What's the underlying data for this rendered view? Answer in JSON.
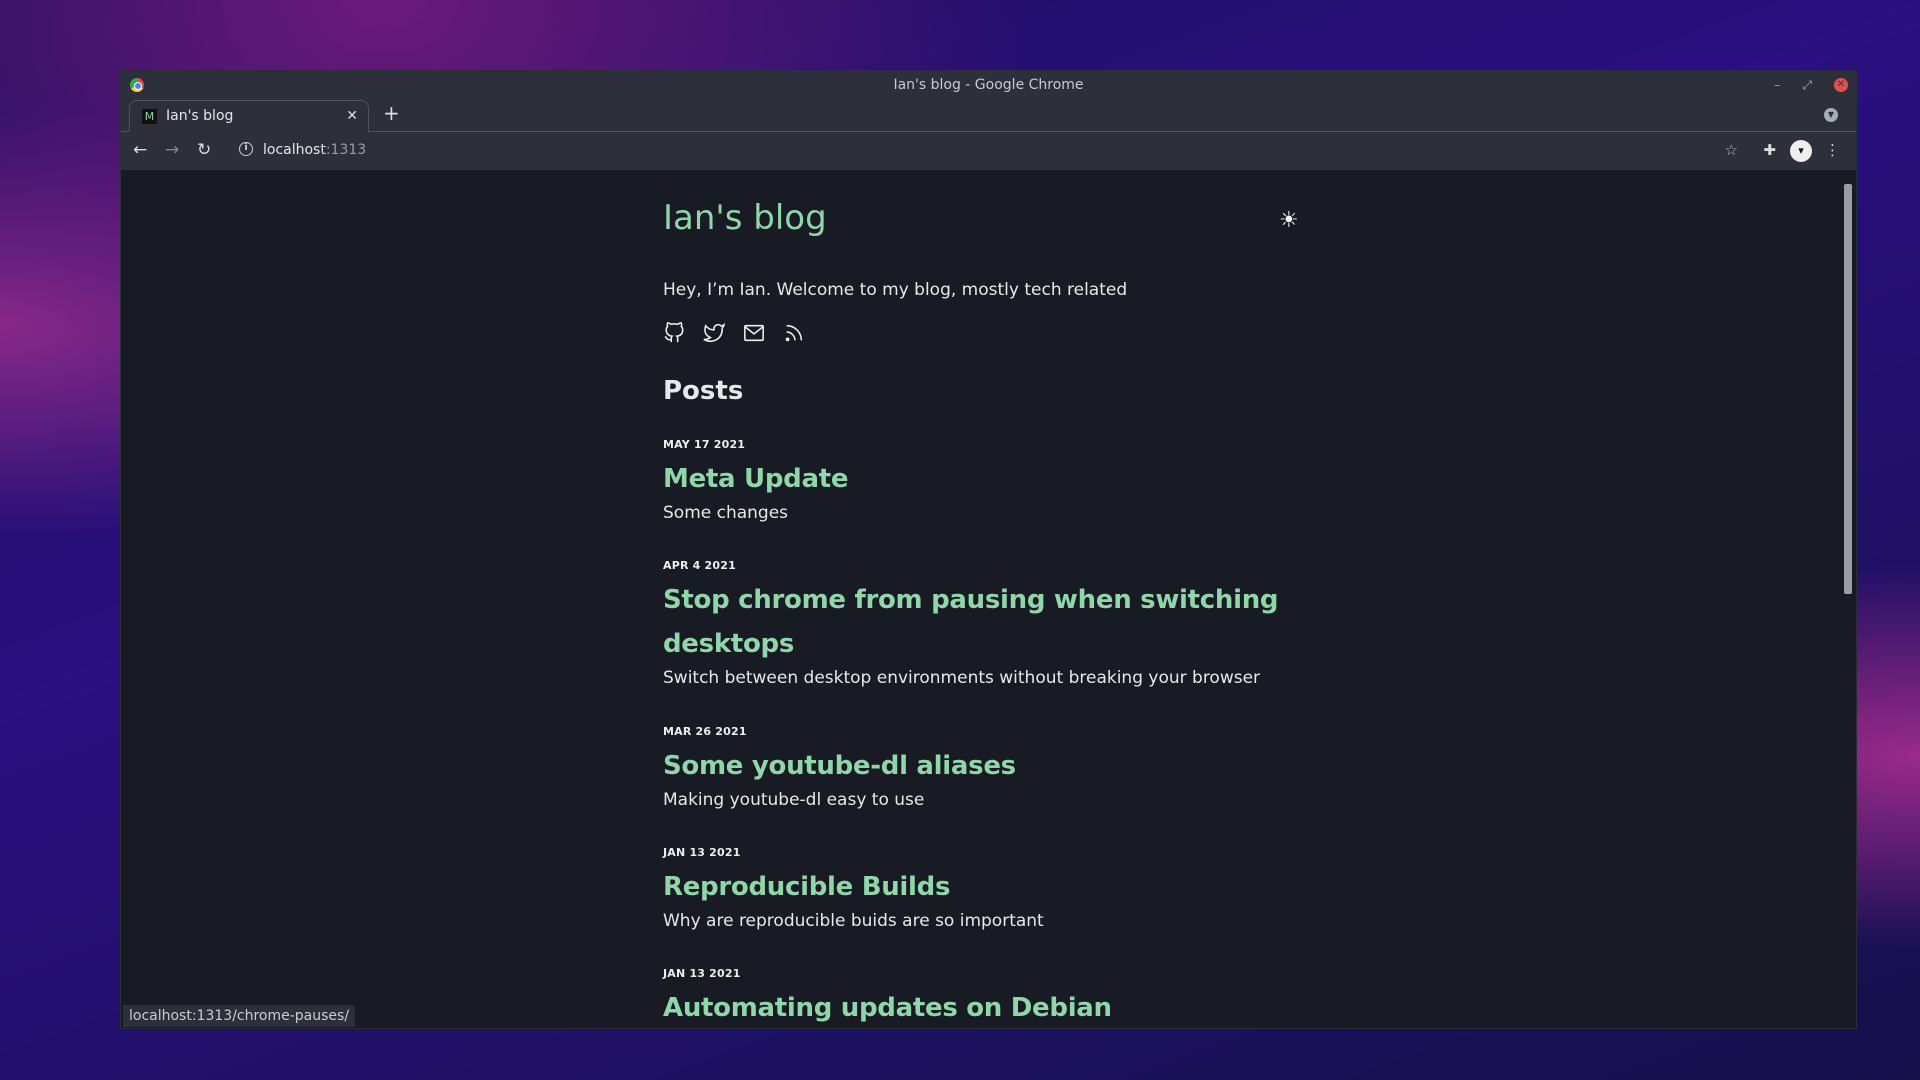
{
  "window": {
    "title": "Ian's blog - Google Chrome"
  },
  "tab": {
    "label": "Ian's blog",
    "favicon": "M"
  },
  "address": {
    "host": "localhost",
    "port": ":1313"
  },
  "status_url": "localhost:1313/chrome-pauses/",
  "page": {
    "site_title": "Ian's blog",
    "intro": "Hey, I’m Ian. Welcome to my blog, mostly tech related",
    "social_icons": [
      "github-icon",
      "twitter-icon",
      "mail-icon",
      "rss-icon"
    ],
    "posts_heading": "Posts",
    "posts": [
      {
        "date": "MAY 17 2021",
        "title": "Meta Update",
        "desc": "Some changes"
      },
      {
        "date": "APR 4 2021",
        "title": "Stop chrome from pausing when switching desktops",
        "desc": "Switch between desktop environments without breaking your browser"
      },
      {
        "date": "MAR 26 2021",
        "title": "Some youtube-dl aliases",
        "desc": "Making youtube-dl easy to use"
      },
      {
        "date": "JAN 13 2021",
        "title": "Reproducible Builds",
        "desc": "Why are reproducible buids are so important"
      },
      {
        "date": "JAN 13 2021",
        "title": "Automating updates on Debian",
        "desc": ""
      }
    ]
  },
  "colors": {
    "accent": "#8fd6a8",
    "background": "#181a24",
    "chrome": "#2d303a"
  }
}
